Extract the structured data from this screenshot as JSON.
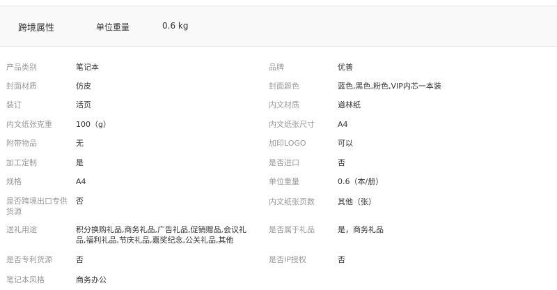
{
  "cross_border": {
    "title": "跨境属性",
    "weight_label": "单位重量",
    "weight_value": "0.6 kg"
  },
  "attributes": [
    {
      "name": "产品类别",
      "value": "笔记本"
    },
    {
      "name": "品牌",
      "value": "优善"
    },
    {
      "name": "封面材质",
      "value": "仿皮"
    },
    {
      "name": "封面颜色",
      "value": "蓝色,黑色,粉色,VIP内芯一本装"
    },
    {
      "name": "装订",
      "value": "活页"
    },
    {
      "name": "内文材质",
      "value": "道林纸"
    },
    {
      "name": "内文纸张克重",
      "value": "100（g）"
    },
    {
      "name": "内文纸张尺寸",
      "value": "A4"
    },
    {
      "name": "附带物品",
      "value": "无"
    },
    {
      "name": "加印LOGO",
      "value": "可以"
    },
    {
      "name": "加工定制",
      "value": "是"
    },
    {
      "name": "是否进口",
      "value": "否"
    },
    {
      "name": "规格",
      "value": "A4"
    },
    {
      "name": "单位重量",
      "value": "0.6（本/册）"
    },
    {
      "name": "是否跨境出口专供货源",
      "value": "否"
    },
    {
      "name": "内文纸张页数",
      "value": "其他（张）"
    },
    {
      "name": "送礼用途",
      "value": "积分换购礼品,商务礼品,广告礼品,促销赠品,会议礼品,福利礼品,节庆礼品,嘉奖纪念,公关礼品,其他"
    },
    {
      "name": "是否属于礼品",
      "value": "是，商务礼品"
    },
    {
      "name": "是否专利货源",
      "value": "否"
    },
    {
      "name": "是否IP授权",
      "value": "否"
    },
    {
      "name": "笔记本风格",
      "value": "商务办公"
    }
  ]
}
